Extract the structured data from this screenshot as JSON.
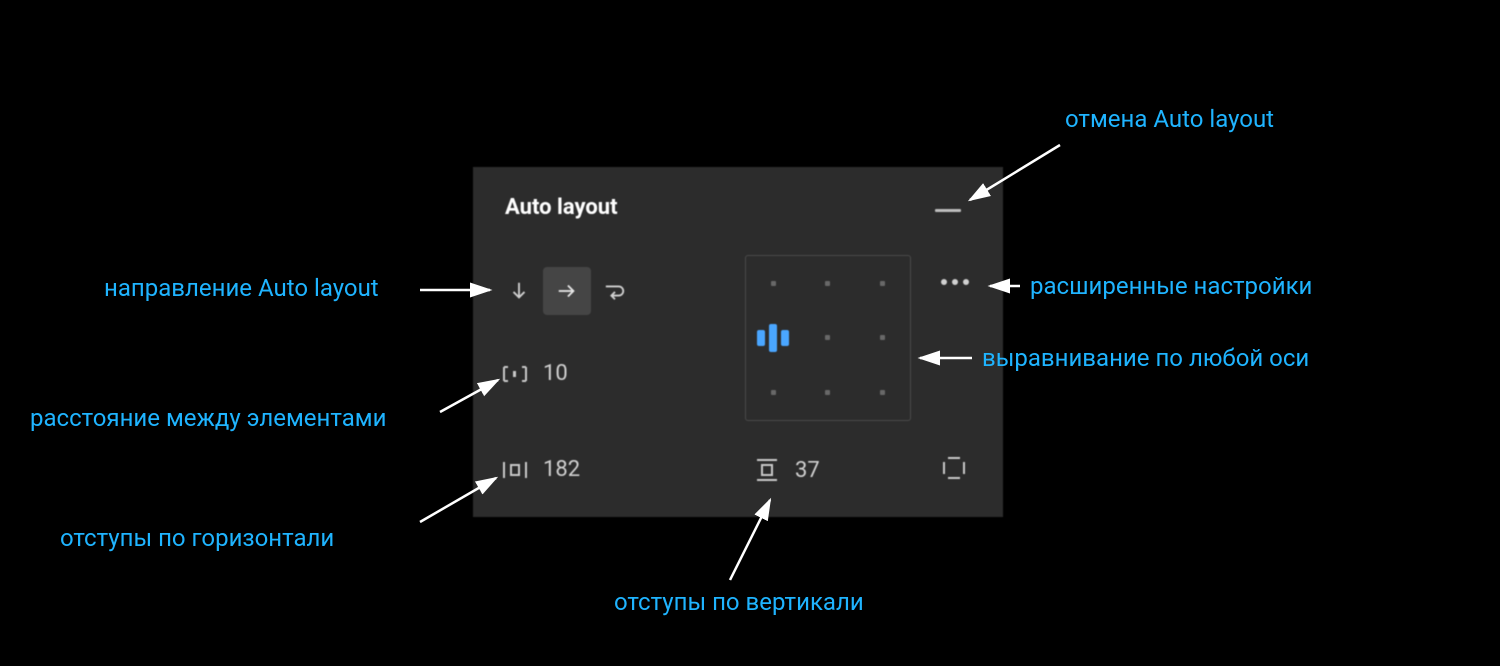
{
  "panel": {
    "title": "Auto layout",
    "spacing_value": "10",
    "hpadding_value": "182",
    "vpadding_value": "37"
  },
  "annotations": {
    "remove": "отмена Auto layout",
    "direction": "направление Auto layout",
    "advanced": "расширенные настройки",
    "alignment": "выравнивание по любой оси",
    "spacing": "расстояние между элементами",
    "hpadding": "отступы по горизонтали",
    "vpadding": "отступы по вертикали"
  },
  "colors": {
    "accent": "#1fb4ff",
    "panel_bg": "#2c2c2c",
    "arrow": "#ffffff"
  }
}
